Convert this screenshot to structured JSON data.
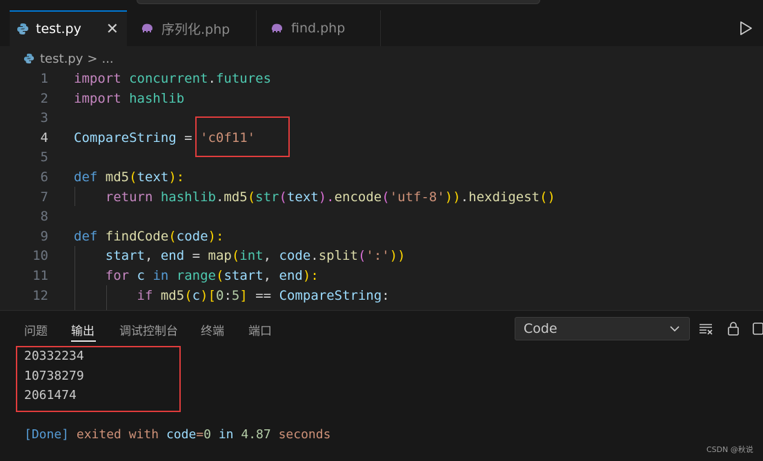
{
  "tabs": [
    {
      "label": "test.py",
      "icon": "python-icon",
      "active": true
    },
    {
      "label": "序列化.php",
      "icon": "php-icon",
      "active": false
    },
    {
      "label": "find.php",
      "icon": "php-icon",
      "active": false
    }
  ],
  "breadcrumb": {
    "file": "test.py",
    "sep": ">",
    "more": "..."
  },
  "editor": {
    "line_numbers": [
      "1",
      "2",
      "3",
      "4",
      "5",
      "6",
      "7",
      "8",
      "9",
      "10",
      "11",
      "12"
    ],
    "current_line": 4,
    "lines": [
      {
        "p": [
          "import",
          " ",
          "concurrent",
          ".",
          "futures"
        ]
      },
      {
        "p": [
          "import",
          " ",
          "hashlib"
        ]
      },
      {
        "p": []
      },
      {
        "p": [
          "CompareString",
          " = ",
          "'c0f11'"
        ]
      },
      {
        "p": []
      },
      {
        "p": [
          "def",
          " ",
          "md5",
          "(",
          "text",
          "):"
        ]
      },
      {
        "p": [
          "    ",
          "return",
          " ",
          "hashlib",
          ".",
          "md5",
          "(",
          "str",
          "(",
          "text",
          ").",
          "encode",
          "(",
          "'utf-8'",
          "))",
          ".",
          "hexdigest",
          "()"
        ]
      },
      {
        "p": []
      },
      {
        "p": [
          "def",
          " ",
          "findCode",
          "(",
          "code",
          "):"
        ]
      },
      {
        "p": [
          "    ",
          "start",
          ", ",
          "end",
          " = ",
          "map",
          "(",
          "int",
          ", ",
          "code",
          ".",
          "split",
          "(",
          "':'",
          "))"
        ]
      },
      {
        "p": [
          "    ",
          "for",
          " ",
          "c",
          " ",
          "in",
          " ",
          "range",
          "(",
          "start",
          ", ",
          "end",
          "):"
        ]
      },
      {
        "p": [
          "        ",
          "if",
          " ",
          "md5",
          "(",
          "c",
          ")[",
          "0",
          ":",
          "5",
          "]",
          " == ",
          "CompareString",
          ":"
        ]
      }
    ]
  },
  "panel": {
    "tabs": [
      "问题",
      "输出",
      "调试控制台",
      "终端",
      "端口"
    ],
    "active_tab": "输出",
    "channel": "Code",
    "output_lines": [
      "20332234",
      "10738279",
      "2061474"
    ],
    "done": {
      "tag": "[Done]",
      "w1": "exited with",
      "var": "code",
      "eq": "=",
      "code": "0",
      "in": "in",
      "time": "4.87",
      "unit": "seconds"
    }
  },
  "watermark": "CSDN @秋说",
  "colors": {
    "accent": "#0078d4",
    "highlight_box": "#e03c3c",
    "background": "#1f1f1f"
  }
}
